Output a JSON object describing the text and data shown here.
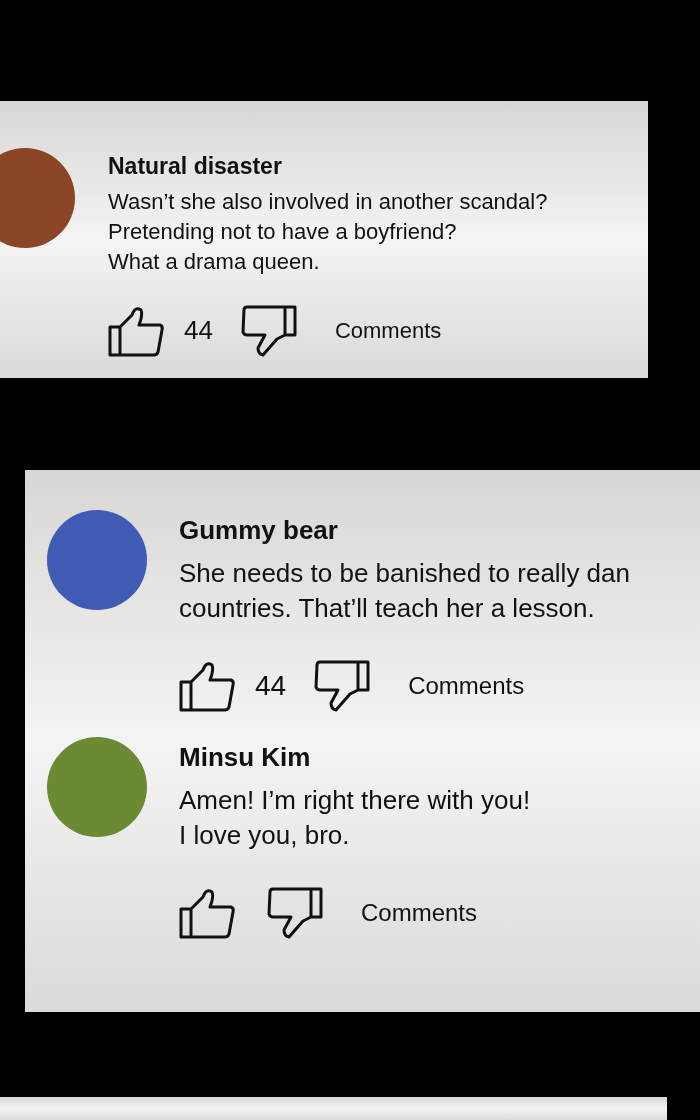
{
  "panels": [
    {
      "kind": "comments",
      "comments": [
        {
          "name": "Natural disaster",
          "color": "#8a4526",
          "text": "Wasn’t she also involved in another scandal?\nPretending not to have a boyfriend?\nWhat a drama queen.",
          "likes": "44",
          "action": "Comments"
        }
      ]
    },
    {
      "kind": "comments",
      "comments": [
        {
          "name": "Gummy bear",
          "color": "#3f5bb4",
          "text": "She needs to be banished to really dan\ncountries. That’ll teach her a lesson.",
          "likes": "44",
          "action": "Comments"
        },
        {
          "name": "Minsu Kim",
          "color": "#6b8a33",
          "text": "Amen! I’m right there with you!\nI love you, bro.",
          "action": "Comments"
        }
      ]
    },
    {
      "kind": "blank"
    }
  ]
}
